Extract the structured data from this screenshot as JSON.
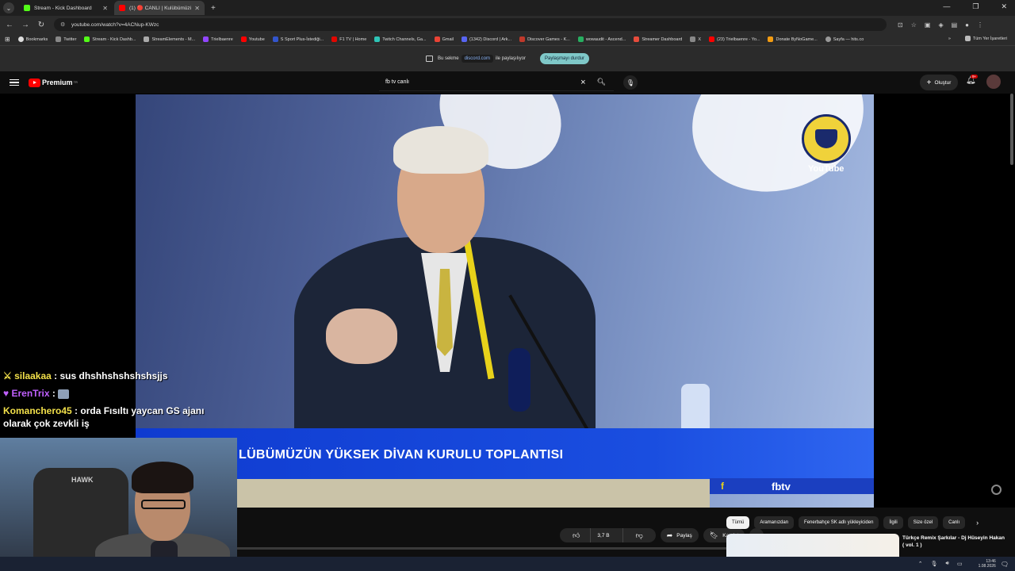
{
  "browser": {
    "tabs": [
      {
        "title": "Stream - Kick Dashboard",
        "favicon_color": "#53fc18"
      },
      {
        "title": "(1) 🔴 CANLI | Kulübümüzü...",
        "favicon_color": "#ff0000"
      }
    ],
    "url": "youtube.com/watch?v=4ACNup-KWzc",
    "bookmarks": [
      {
        "label": "Bookmarks",
        "icon": "star-icon"
      },
      {
        "label": "Twitter",
        "icon": "x-icon"
      },
      {
        "label": "Stream - Kick Dashb...",
        "icon": "kick-icon"
      },
      {
        "label": "StreamElements - M...",
        "icon": "download-icon"
      },
      {
        "label": "Trielbaenre",
        "icon": "twitch-icon"
      },
      {
        "label": "Youtube",
        "icon": "youtube-icon"
      },
      {
        "label": "S Sport Plus-İstediği...",
        "icon": "s-icon"
      },
      {
        "label": "F1 TV | Home",
        "icon": "f1-icon"
      },
      {
        "label": "Twitch Channels, Ga...",
        "icon": "tt-icon"
      },
      {
        "label": "Gmail",
        "icon": "gmail-icon"
      },
      {
        "label": "(1342) Discord | Ark...",
        "icon": "discord-icon"
      },
      {
        "label": "Discover Games - K...",
        "icon": "k-icon"
      },
      {
        "label": "wowaudit - Ascend...",
        "icon": "wow-icon"
      },
      {
        "label": "Streamer Dashboard",
        "icon": "streamer-icon"
      },
      {
        "label": "X",
        "icon": "x-icon"
      },
      {
        "label": "(23) Trielbaenre - Yo...",
        "icon": "youtube-icon"
      },
      {
        "label": "Donate ByNoGame...",
        "icon": "donate-icon"
      },
      {
        "label": "Sayfa — hits.co",
        "icon": "globe-icon"
      }
    ],
    "bookmarks_more": "»",
    "all_bookmarks": "Tüm Yer İşaretleri"
  },
  "share_bar": {
    "prefix": "Bu sekme",
    "domain": "discord.com",
    "suffix": "ile paylaşılıyor",
    "stop_label": "Paylaşmayı durdur"
  },
  "youtube": {
    "logo_text": "Premium",
    "logo_region": "TR",
    "search_query": "fb tv canlı",
    "create_label": "Oluştur",
    "notification_count": "9+"
  },
  "video": {
    "banner_text": "LÜBÜMÜZÜN YÜKSEK DİVAN KURULU TOPLANTISI",
    "brand": "fbtv",
    "watermark": "YouTube"
  },
  "chat": [
    {
      "user": "silaakaa",
      "message": "sus dhshhshshshshsjjs"
    },
    {
      "user": "ErenTrix",
      "message": ""
    },
    {
      "user": "Komanchero45",
      "message": "orda Fısıltı yaycan GS ajanı olarak çok zevkli iş"
    }
  ],
  "webcam": {
    "chair_logo": "HAWK"
  },
  "actions": {
    "likes": "3,7 B",
    "share": "Paylaş",
    "save": "Kaydet"
  },
  "chips": [
    "Tümü",
    "Aramanızdan",
    "Fenerbahçe SK adlı yükleyiciden",
    "İlgili",
    "Size özel",
    "Canlı"
  ],
  "recommendation": {
    "title": "Türkçe Remix Şarkılar - Dj Hüseyin Hakan ( vol. 1 )"
  },
  "taskbar": {
    "time": "13:46",
    "date": "1.08.2026"
  }
}
